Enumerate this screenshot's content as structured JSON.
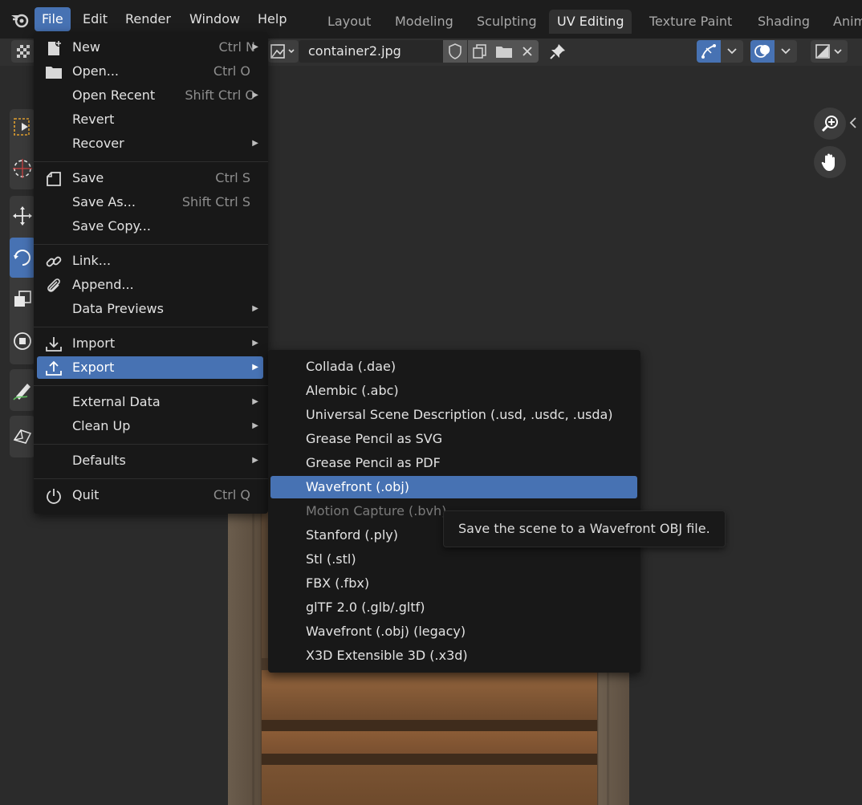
{
  "topbar": {
    "menus": [
      "File",
      "Edit",
      "Render",
      "Window",
      "Help"
    ],
    "active_menu": "File",
    "workspaces": [
      "Layout",
      "Modeling",
      "Sculpting",
      "UV Editing",
      "Texture Paint",
      "Shading",
      "Anim"
    ],
    "active_workspace": "UV Editing"
  },
  "image_editor": {
    "image_name": "container2.jpg"
  },
  "file_menu": {
    "items": [
      {
        "label": "New",
        "shortcut": "Ctrl N",
        "icon": "new-file-icon",
        "submenu": true
      },
      {
        "label": "Open...",
        "shortcut": "Ctrl O",
        "icon": "folder-icon",
        "submenu": false
      },
      {
        "label": "Open Recent",
        "shortcut": "Shift Ctrl O",
        "icon": "",
        "submenu": true
      },
      {
        "label": "Revert",
        "shortcut": "",
        "icon": "",
        "submenu": false
      },
      {
        "label": "Recover",
        "shortcut": "",
        "icon": "",
        "submenu": true
      },
      {
        "label": "Save",
        "shortcut": "Ctrl S",
        "icon": "save-icon",
        "submenu": false
      },
      {
        "label": "Save As...",
        "shortcut": "Shift Ctrl S",
        "icon": "",
        "submenu": false
      },
      {
        "label": "Save Copy...",
        "shortcut": "",
        "icon": "",
        "submenu": false
      },
      {
        "label": "Link...",
        "shortcut": "",
        "icon": "link-icon",
        "submenu": false
      },
      {
        "label": "Append...",
        "shortcut": "",
        "icon": "paperclip-icon",
        "submenu": false
      },
      {
        "label": "Data Previews",
        "shortcut": "",
        "icon": "",
        "submenu": true
      },
      {
        "label": "Import",
        "shortcut": "",
        "icon": "import-icon",
        "submenu": true
      },
      {
        "label": "Export",
        "shortcut": "",
        "icon": "export-icon",
        "submenu": true
      },
      {
        "label": "External Data",
        "shortcut": "",
        "icon": "",
        "submenu": true
      },
      {
        "label": "Clean Up",
        "shortcut": "",
        "icon": "",
        "submenu": true
      },
      {
        "label": "Defaults",
        "shortcut": "",
        "icon": "",
        "submenu": true
      },
      {
        "label": "Quit",
        "shortcut": "Ctrl Q",
        "icon": "power-icon",
        "submenu": false
      }
    ],
    "highlighted": "Export"
  },
  "export_menu": {
    "items": [
      {
        "label": "Collada (.dae)"
      },
      {
        "label": "Alembic (.abc)"
      },
      {
        "label": "Universal Scene Description (.usd, .usdc, .usda)"
      },
      {
        "label": "Grease Pencil as SVG"
      },
      {
        "label": "Grease Pencil as PDF"
      },
      {
        "label": "Wavefront (.obj)"
      },
      {
        "label": "Motion Capture (.bvh)"
      },
      {
        "label": "Stanford (.ply)"
      },
      {
        "label": "Stl (.stl)"
      },
      {
        "label": "FBX (.fbx)"
      },
      {
        "label": "glTF 2.0 (.glb/.gltf)"
      },
      {
        "label": "Wavefront (.obj) (legacy)"
      },
      {
        "label": "X3D Extensible 3D (.x3d)"
      }
    ],
    "highlighted": "Wavefront (.obj)",
    "disabled": "Motion Capture (.bvh)"
  },
  "tooltip": {
    "text": "Save the scene to a Wavefront OBJ file."
  },
  "colors": {
    "accent": "#4772b3",
    "menu_bg": "#181818",
    "topbar_bg": "#1d1d1d"
  }
}
